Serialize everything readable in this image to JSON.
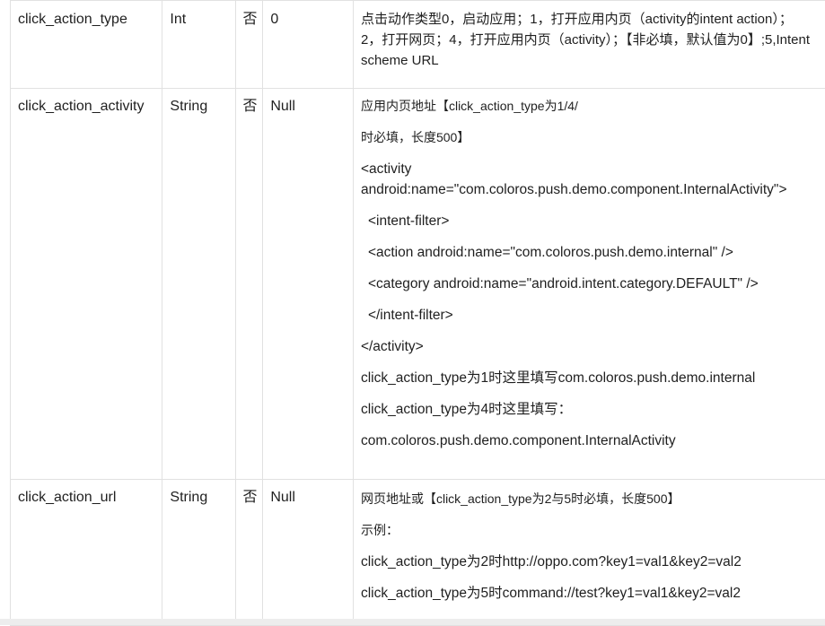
{
  "rows": [
    {
      "name": "click_action_type",
      "type": "Int",
      "required": "否",
      "default": "0",
      "desc": [
        "点击动作类型0，启动应用；1，打开应用内页（activity的intent action）；",
        "2，打开网页；4，打开应用内页（activity）；【非必填，默认值为0】;5,Intent",
        "scheme URL"
      ]
    },
    {
      "name": "click_action_activity",
      "type": "String",
      "required": "否",
      "default": "Null",
      "desc": [
        "应用内页地址【click_action_type为1/4/",
        "时必填，长度500】",
        "<activity android:name=\"com.coloros.push.demo.component.InternalActivity\">",
        "<intent-filter>",
        "<action android:name=\"com.coloros.push.demo.internal\" />",
        "<category android:name=\"android.intent.category.DEFAULT\" />",
        "</intent-filter>",
        "</activity>",
        "click_action_type为1时这里填写com.coloros.push.demo.internal",
        "click_action_type为4时这里填写：",
        "com.coloros.push.demo.component.InternalActivity"
      ]
    },
    {
      "name": "click_action_url",
      "type": "String",
      "required": "否",
      "default": "Null",
      "desc": [
        "网页地址或【click_action_type为2与5时必填，长度500】",
        "示例：",
        "click_action_type为2时http://oppo.com?key1=val1&key2=val2",
        "click_action_type为5时command://test?key1=val1&key2=val2"
      ]
    }
  ]
}
